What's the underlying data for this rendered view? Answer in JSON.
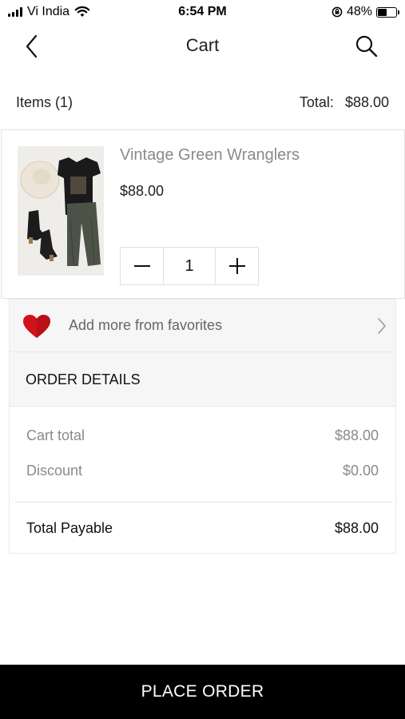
{
  "status_bar": {
    "carrier": "Vi India",
    "time": "6:54 PM",
    "battery_percent": "48%",
    "battery_level": 0.48,
    "icons": [
      "signal-icon",
      "wifi-icon",
      "orientation-lock-icon",
      "battery-icon"
    ]
  },
  "header": {
    "title": "Cart",
    "back_icon": "chevron-left-icon",
    "search_icon": "search-icon"
  },
  "summary": {
    "items_label": "Items (1)",
    "total_label": "Total:",
    "total_value": "$88.00"
  },
  "cart_items": [
    {
      "name": "Vintage Green Wranglers",
      "price": "$88.00",
      "quantity": "1",
      "minus_icon": "minus-icon",
      "plus_icon": "plus-icon"
    }
  ],
  "favorites": {
    "label": "Add more from favorites",
    "icon": "heart-icon",
    "chevron": "chevron-right-icon",
    "heart_color": "#d0121b"
  },
  "order_details": {
    "title": "ORDER DETAILS",
    "rows": [
      {
        "label": "Cart total",
        "value": "$88.00"
      },
      {
        "label": "Discount",
        "value": "$0.00"
      }
    ],
    "total_label": "Total Payable",
    "total_value": "$88.00"
  },
  "place_order": {
    "label": "PLACE ORDER",
    "color": "#000000"
  }
}
